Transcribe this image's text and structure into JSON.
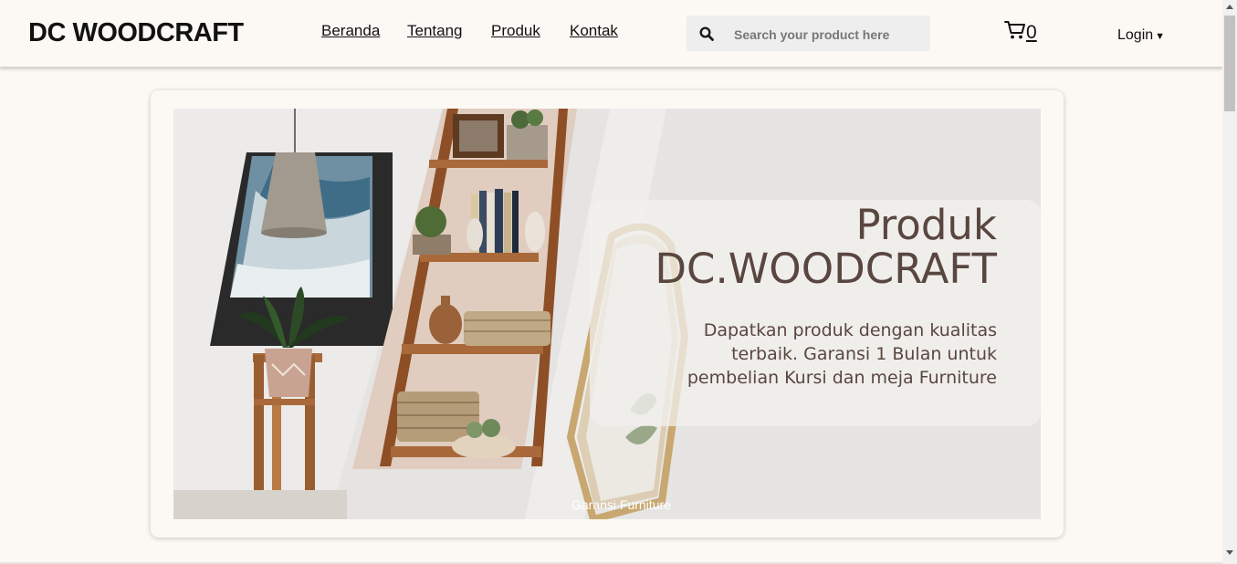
{
  "brand": "DC WOODCRAFT",
  "nav": {
    "links": [
      "Beranda",
      "Tentang",
      "Produk",
      "Kontak"
    ]
  },
  "search": {
    "placeholder": "Search your product here",
    "icon": "search-icon"
  },
  "cart": {
    "icon": "cart-icon",
    "count": "0"
  },
  "login": {
    "label": "Login",
    "icon": "caret-down-icon"
  },
  "hero": {
    "title_line1": "Produk",
    "title_line2": "DC.WOODCRAFT",
    "description": "Dapatkan produk dengan kualitas terbaik. Garansi 1 Bulan untuk pembelian Kursi dan meja Furniture",
    "caption": "Garansi Furniture"
  },
  "colors": {
    "page_background": "#fcf9f5",
    "hero_text": "#5a4640",
    "wood": "#a9693a",
    "banner_background": "#e5e4e3"
  }
}
